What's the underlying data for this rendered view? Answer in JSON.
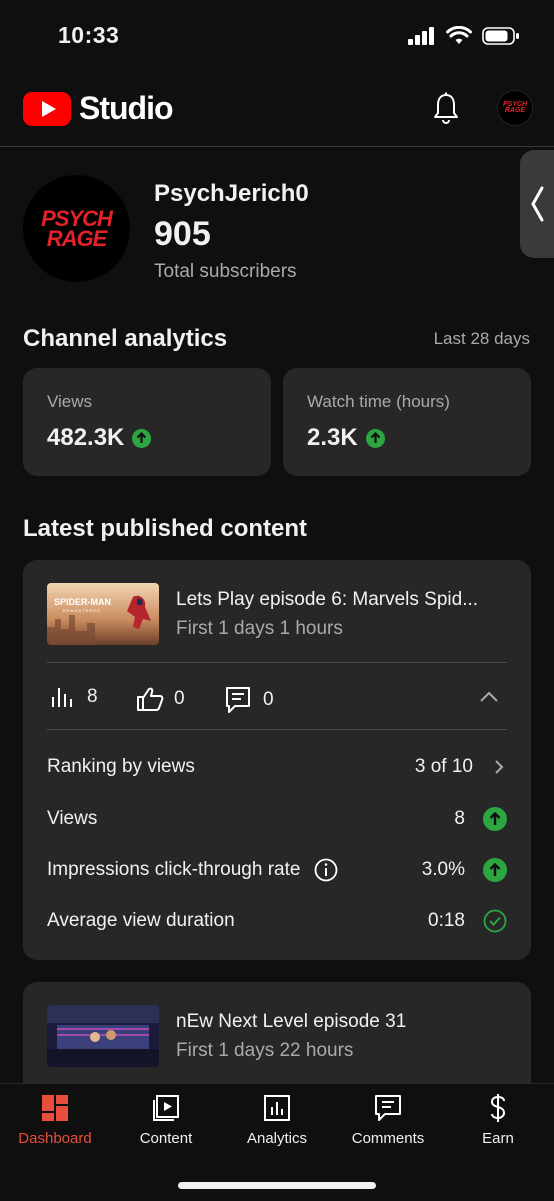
{
  "status_bar": {
    "time": "10:33"
  },
  "header": {
    "app_name": "Studio",
    "avatar_text_1": "PSYCH",
    "avatar_text_2": "RAGE"
  },
  "channel": {
    "avatar_text_1": "PSYCH",
    "avatar_text_2": "RAGE",
    "name": "PsychJerich0",
    "subscribers": "905",
    "subscribers_label": "Total subscribers"
  },
  "analytics": {
    "title": "Channel analytics",
    "range": "Last 28 days",
    "cards": [
      {
        "label": "Views",
        "value": "482.3K"
      },
      {
        "label": "Watch time (hours)",
        "value": "2.3K"
      }
    ]
  },
  "latest": {
    "title": "Latest published content",
    "items": [
      {
        "thumb_text_1": "SPIDER-MAN",
        "thumb_text_2": "REMASTERED",
        "title": "Lets Play episode 6: Marvels Spid...",
        "subtitle": "First 1 days 1 hours",
        "views": "8",
        "likes": "0",
        "comments": "0",
        "rows": [
          {
            "label": "Ranking by views",
            "value": "3 of 10"
          },
          {
            "label": "Views",
            "value": "8"
          },
          {
            "label": "Impressions click-through rate",
            "value": "3.0%"
          },
          {
            "label": "Average view duration",
            "value": "0:18"
          }
        ]
      },
      {
        "title": "nEw Next Level episode 31",
        "subtitle": "First 1 days 22 hours"
      }
    ]
  },
  "tabs": [
    {
      "label": "Dashboard",
      "icon": "dashboard-icon"
    },
    {
      "label": "Content",
      "icon": "content-icon"
    },
    {
      "label": "Analytics",
      "icon": "analytics-icon"
    },
    {
      "label": "Comments",
      "icon": "comments-icon"
    },
    {
      "label": "Earn",
      "icon": "dollar-icon"
    }
  ],
  "colors": {
    "accent": "#ff0000",
    "active_tab": "#e84e3b",
    "positive": "#2ba640",
    "card": "#272727",
    "background": "#0f0f0f"
  }
}
